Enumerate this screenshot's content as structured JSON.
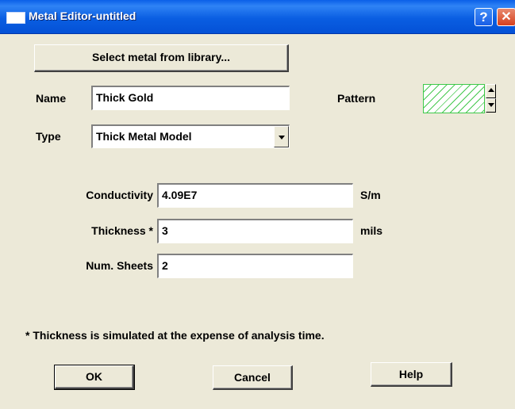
{
  "window": {
    "title": "Metal Editor-untitled",
    "help_glyph": "?",
    "close_glyph": "✕"
  },
  "buttons": {
    "select_from_library": "Select metal from library...",
    "ok": "OK",
    "cancel": "Cancel",
    "help": "Help"
  },
  "name": {
    "label": "Name",
    "value": "Thick Gold"
  },
  "pattern": {
    "label": "Pattern",
    "hatch_color": "#46c84f"
  },
  "type": {
    "label": "Type",
    "selected": "Thick Metal Model"
  },
  "conductivity": {
    "label": "Conductivity",
    "value": "4.09E7",
    "unit": "S/m"
  },
  "thickness": {
    "label": "Thickness *",
    "value": "3",
    "unit": "mils"
  },
  "num_sheets": {
    "label": "Num. Sheets",
    "value": "2"
  },
  "note": "* Thickness is simulated at the expense of analysis time."
}
